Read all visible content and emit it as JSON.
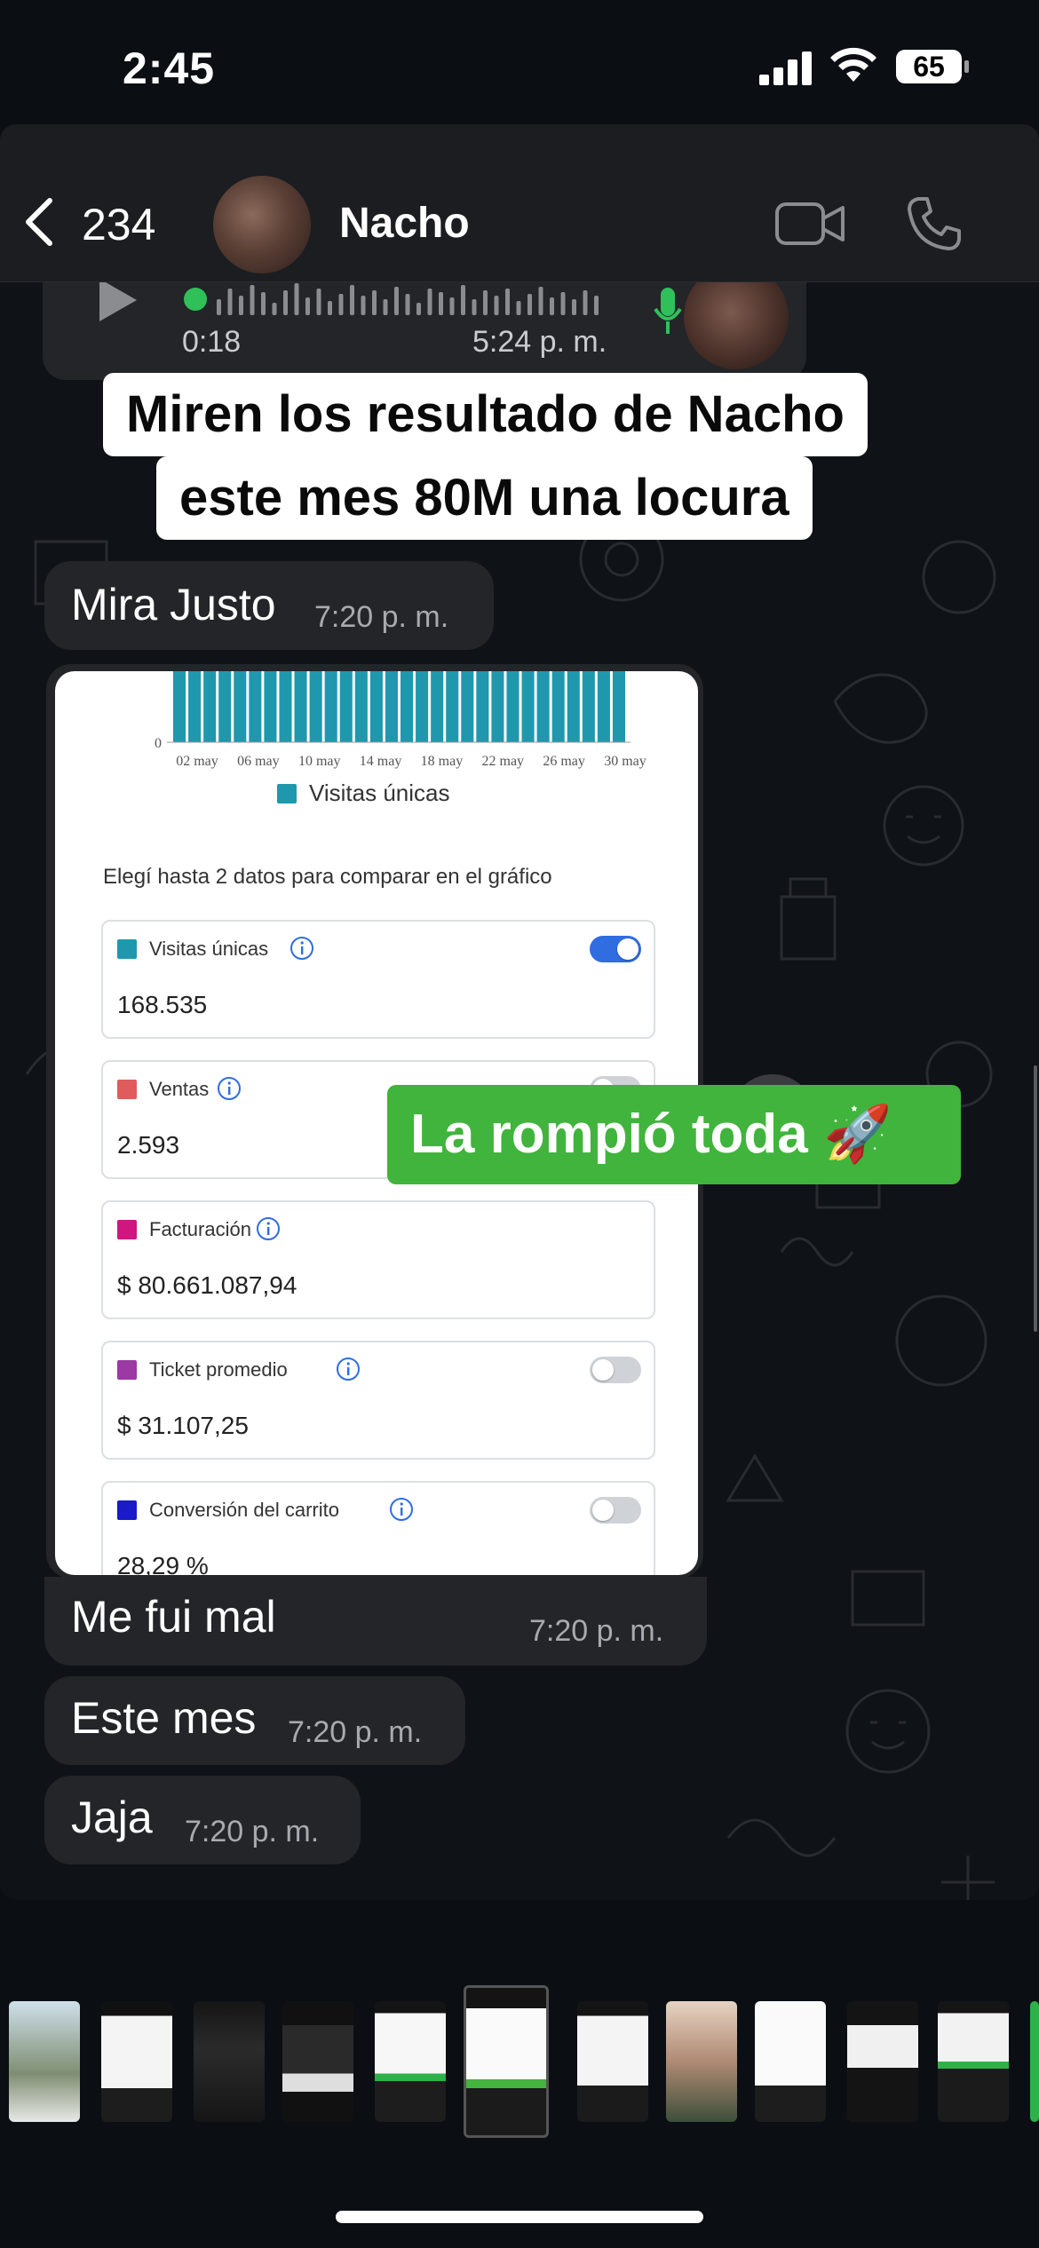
{
  "status_bar": {
    "time": "2:45",
    "battery": "65"
  },
  "header": {
    "back_count": "234",
    "contact_name": "Nacho"
  },
  "voice_message": {
    "duration": "0:18",
    "time": "5:24 p. m."
  },
  "caption": {
    "line1": "Miren los resultado de Nacho",
    "line2": "este mes 80M una locura"
  },
  "messages": [
    {
      "text": "Mira Justo",
      "time": "7:20 p. m."
    },
    {
      "text": "Me fui mal",
      "time": "7:20 p. m."
    },
    {
      "text": "Este mes",
      "time": "7:20 p. m."
    },
    {
      "text": "Jaja",
      "time": "7:20 p. m."
    }
  ],
  "screenshot": {
    "legend": "Visitas únicas",
    "compare_title": "Elegí hasta 2 datos para comparar en el gráfico",
    "metrics": [
      {
        "label": "Visitas únicas",
        "value": "168.535",
        "color": "#1f98ad",
        "toggle_on": true
      },
      {
        "label": "Ventas",
        "value": "2.593",
        "color": "#e05c5c",
        "toggle_on": false
      },
      {
        "label": "Facturación",
        "value": "$ 80.661.087,94",
        "color": "#d0167f",
        "toggle_on": false
      },
      {
        "label": "Ticket promedio",
        "value": "$ 31.107,25",
        "color": "#9a3aa2",
        "toggle_on": false
      },
      {
        "label": "Conversión del carrito",
        "value": "28,29 %",
        "color": "#1a1ac8",
        "toggle_on": false
      }
    ]
  },
  "green_caption": "La rompió toda 🚀",
  "chart_data": {
    "type": "bar",
    "series": [
      {
        "name": "Visitas únicas"
      }
    ],
    "x_ticks": [
      "02 may",
      "06 may",
      "10 may",
      "14 may",
      "18 may",
      "22 may",
      "26 may",
      "30 may"
    ],
    "y_ticks": [
      "0"
    ],
    "bar_color": "#1f98ad",
    "bar_count": 30
  },
  "colors": {
    "accent_green": "#40b43c",
    "bubble": "#232528",
    "toggle_on": "#2f6de1"
  }
}
